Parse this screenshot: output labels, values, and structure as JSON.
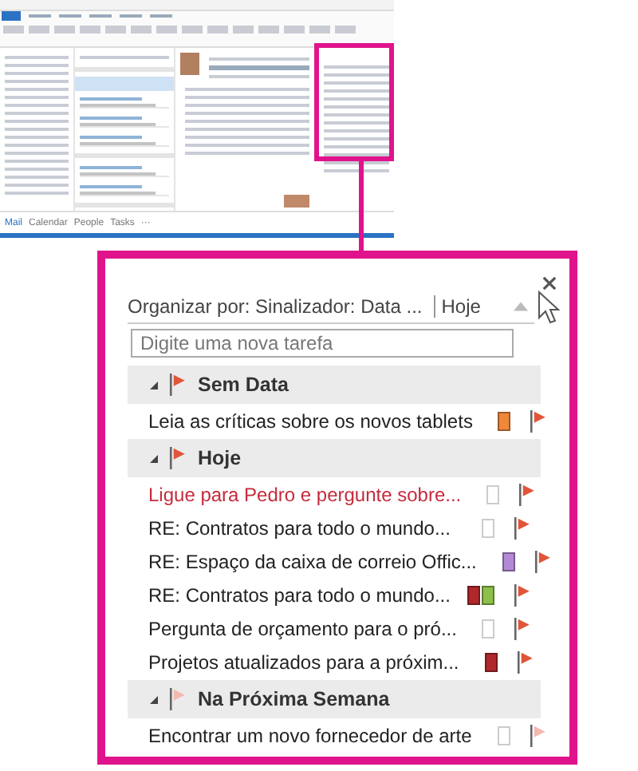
{
  "outlook_window": {
    "nav_items": [
      {
        "label": "Mail",
        "selected": true
      },
      {
        "label": "Calendar",
        "selected": false
      },
      {
        "label": "People",
        "selected": false
      },
      {
        "label": "Tasks",
        "selected": false
      },
      {
        "label": "···",
        "selected": false
      }
    ]
  },
  "task_pane": {
    "arrange_by": "Organizar por: Sinalizador: Data ...",
    "sort": "Hoje",
    "new_task": {
      "placeholder": "Digite uma nova tarefa"
    },
    "groups": [
      {
        "title": "Sem Data",
        "flag_faded": false,
        "tasks": [
          {
            "title": "Leia as críticas sobre os novos tablets",
            "overdue": false,
            "flag_faded": false,
            "categories": [
              {
                "color": "#f0883c"
              }
            ]
          }
        ]
      },
      {
        "title": "Hoje",
        "flag_faded": false,
        "tasks": [
          {
            "title": "Ligue para Pedro e pergunte sobre...",
            "overdue": true,
            "flag_faded": false
          },
          {
            "title": "RE: Contratos para todo o mundo...",
            "overdue": false,
            "flag_faded": false
          },
          {
            "title": "RE: Espaço da caixa de correio Offic...",
            "overdue": false,
            "flag_faded": false,
            "categories": [
              {
                "color": "#b48ad6"
              }
            ]
          },
          {
            "title": "RE: Contratos para todo o mundo...",
            "overdue": false,
            "flag_faded": false,
            "categories": [
              {
                "color": "#b0282c"
              },
              {
                "color": "#8cc04a"
              }
            ]
          },
          {
            "title": "Pergunta de orçamento para o pró...",
            "overdue": false,
            "flag_faded": false
          },
          {
            "title": "Projetos atualizados para a próxim...",
            "overdue": false,
            "flag_faded": false,
            "categories": [
              {
                "color": "#b0282c"
              }
            ]
          }
        ]
      },
      {
        "title": "Na Próxima Semana",
        "flag_faded": true,
        "tasks": [
          {
            "title": "Encontrar um novo fornecedor de arte",
            "overdue": false,
            "flag_faded": true
          }
        ]
      }
    ]
  }
}
